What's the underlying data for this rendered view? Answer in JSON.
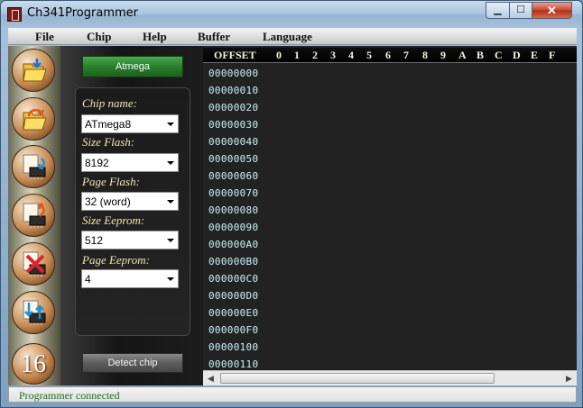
{
  "window": {
    "title": "Ch341Programmer"
  },
  "menu": [
    "File",
    "Chip",
    "Help",
    "Buffer",
    "Language"
  ],
  "toolbar": {
    "buttons": [
      "open-file-icon",
      "save-file-icon",
      "read-chip-icon",
      "write-chip-icon",
      "erase-chip-icon",
      "verify-chip-icon"
    ],
    "last_button_label": "16"
  },
  "chip_panel": {
    "family_button": "Atmega",
    "fields": [
      {
        "label": "Chip name:",
        "value": "ATmega8"
      },
      {
        "label": "Size Flash:",
        "value": "8192"
      },
      {
        "label": "Page Flash:",
        "value": "32 (word)"
      },
      {
        "label": "Size Eeprom:",
        "value": "512"
      },
      {
        "label": "Page Eeprom:",
        "value": "4"
      }
    ],
    "detect_button": "Detect chip"
  },
  "hex_view": {
    "offset_header": "OFFSET",
    "column_headers": [
      "0",
      "1",
      "2",
      "3",
      "4",
      "5",
      "6",
      "7",
      "8",
      "9",
      "A",
      "B",
      "C",
      "D",
      "E",
      "F"
    ],
    "offsets": [
      "00000000",
      "00000010",
      "00000020",
      "00000030",
      "00000040",
      "00000050",
      "00000060",
      "00000070",
      "00000080",
      "00000090",
      "000000A0",
      "000000B0",
      "000000C0",
      "000000D0",
      "000000E0",
      "000000F0",
      "00000100",
      "00000110"
    ]
  },
  "status": {
    "text": "Programmer connected"
  },
  "colors": {
    "status_text": "#177717",
    "offset_text": "#c8f3f7",
    "label_text": "#f1e6b8",
    "atmega_button": "#2b7d2e"
  }
}
